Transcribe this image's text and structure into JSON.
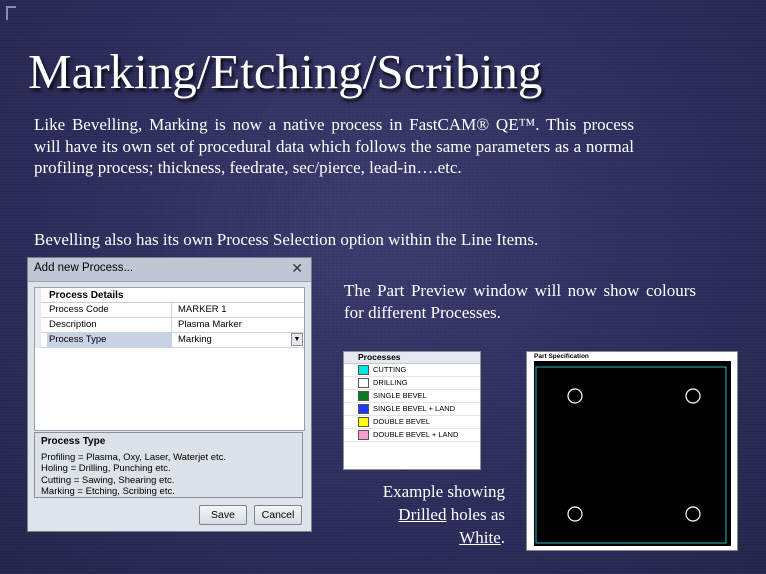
{
  "slide": {
    "title": "Marking/Etching/Scribing",
    "paragraph1": "Like Bevelling, Marking is now a native process in FastCAM® QE™. This process will have its own set of procedural data which follows the same parameters as a normal profiling process; thickness, feedrate, sec/pierce, lead-in….etc.",
    "paragraph2": "Bevelling also has its own Process Selection option within the Line Items.",
    "preview_note": "The Part Preview window will now show colours for different Processes.",
    "example_prefix": "Example showing",
    "example_drilled": "Drilled",
    "example_mid": "holes as",
    "example_white": "White",
    "example_end": "."
  },
  "dialog": {
    "title": "Add new Process...",
    "close_glyph": "✕",
    "section_label": "Process Details",
    "rows": [
      {
        "key": "Process Code",
        "value": "MARKER 1"
      },
      {
        "key": "Description",
        "value": "Plasma Marker"
      },
      {
        "key": "Process Type",
        "value": "Marking"
      }
    ],
    "dropdown_glyph": "▼",
    "help_title": "Process Type",
    "help_lines": [
      "Profiling  = Plasma, Oxy, Laser, Waterjet etc.",
      "Holing  = Drilling, Punching etc.",
      "Cutting  = Sawing, Shearing etc.",
      "Marking  = Etching, Scribing etc."
    ],
    "save_label": "Save",
    "cancel_label": "Cancel"
  },
  "legend": {
    "title": "Processes",
    "items": [
      {
        "label": "CUTTING",
        "color": "#00e5e5"
      },
      {
        "label": "DRILLING",
        "color": "#ffffff"
      },
      {
        "label": "SINGLE BEVEL",
        "color": "#0a7a1a"
      },
      {
        "label": "SINGLE BEVEL + LAND",
        "color": "#1b3df2"
      },
      {
        "label": "DOUBLE BEVEL",
        "color": "#ffff00"
      },
      {
        "label": "DOUBLE BEVEL + LAND",
        "color": "#f4a0c8"
      }
    ]
  },
  "part_preview": {
    "title": "Part Specification",
    "outline_color": "#2bb5c8",
    "hole_color": "#ffffff"
  }
}
